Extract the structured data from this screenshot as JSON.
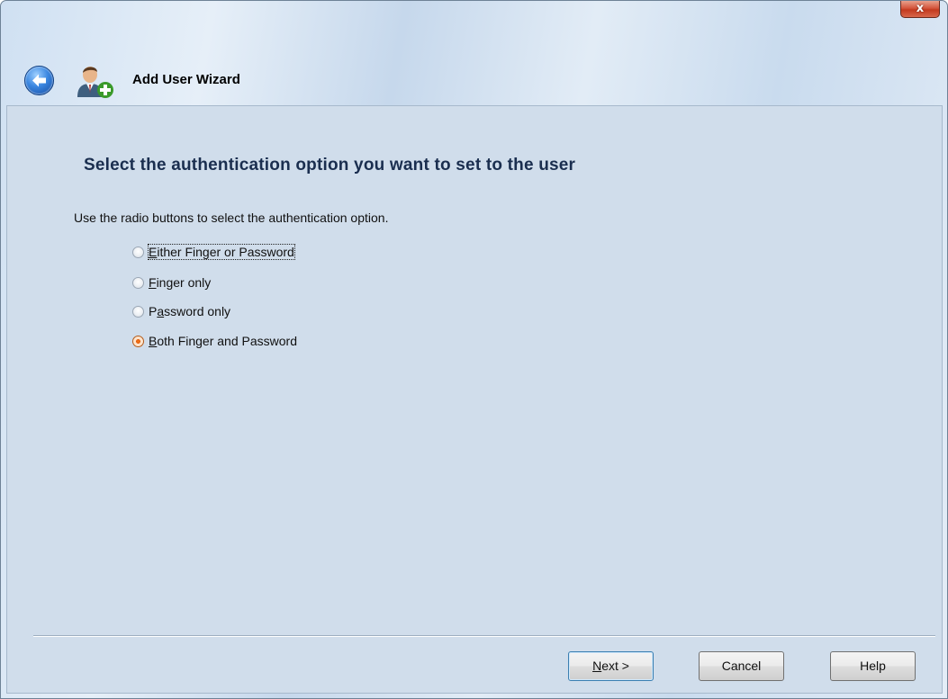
{
  "window": {
    "title": "Add User Wizard",
    "close_label": "x"
  },
  "icons": {
    "back": "back-arrow-icon",
    "user_add": "add-user-icon"
  },
  "page": {
    "heading": "Select the authentication option you want to set to the user",
    "instruction": "Use the radio buttons to select the authentication option.",
    "options": [
      {
        "mnemonic": "E",
        "rest": "ither Finger or Password",
        "checked": false,
        "focused": true
      },
      {
        "mnemonic": "F",
        "rest": "inger only",
        "checked": false,
        "focused": false
      },
      {
        "pre": "P",
        "mnemonic": "a",
        "rest": "ssword only",
        "checked": false,
        "focused": false
      },
      {
        "mnemonic": "B",
        "rest": "oth Finger and Password",
        "checked": true,
        "focused": false
      }
    ],
    "selected_option": "Both Finger and Password"
  },
  "buttons": {
    "next": {
      "mnemonic": "N",
      "rest": "ext >"
    },
    "cancel": "Cancel",
    "help": "Help"
  },
  "colors": {
    "heading": "#1a2e4f",
    "content_bg": "#d0ddeb",
    "radio_selected": "#e25a0a",
    "close_button": "#c33a1f"
  }
}
